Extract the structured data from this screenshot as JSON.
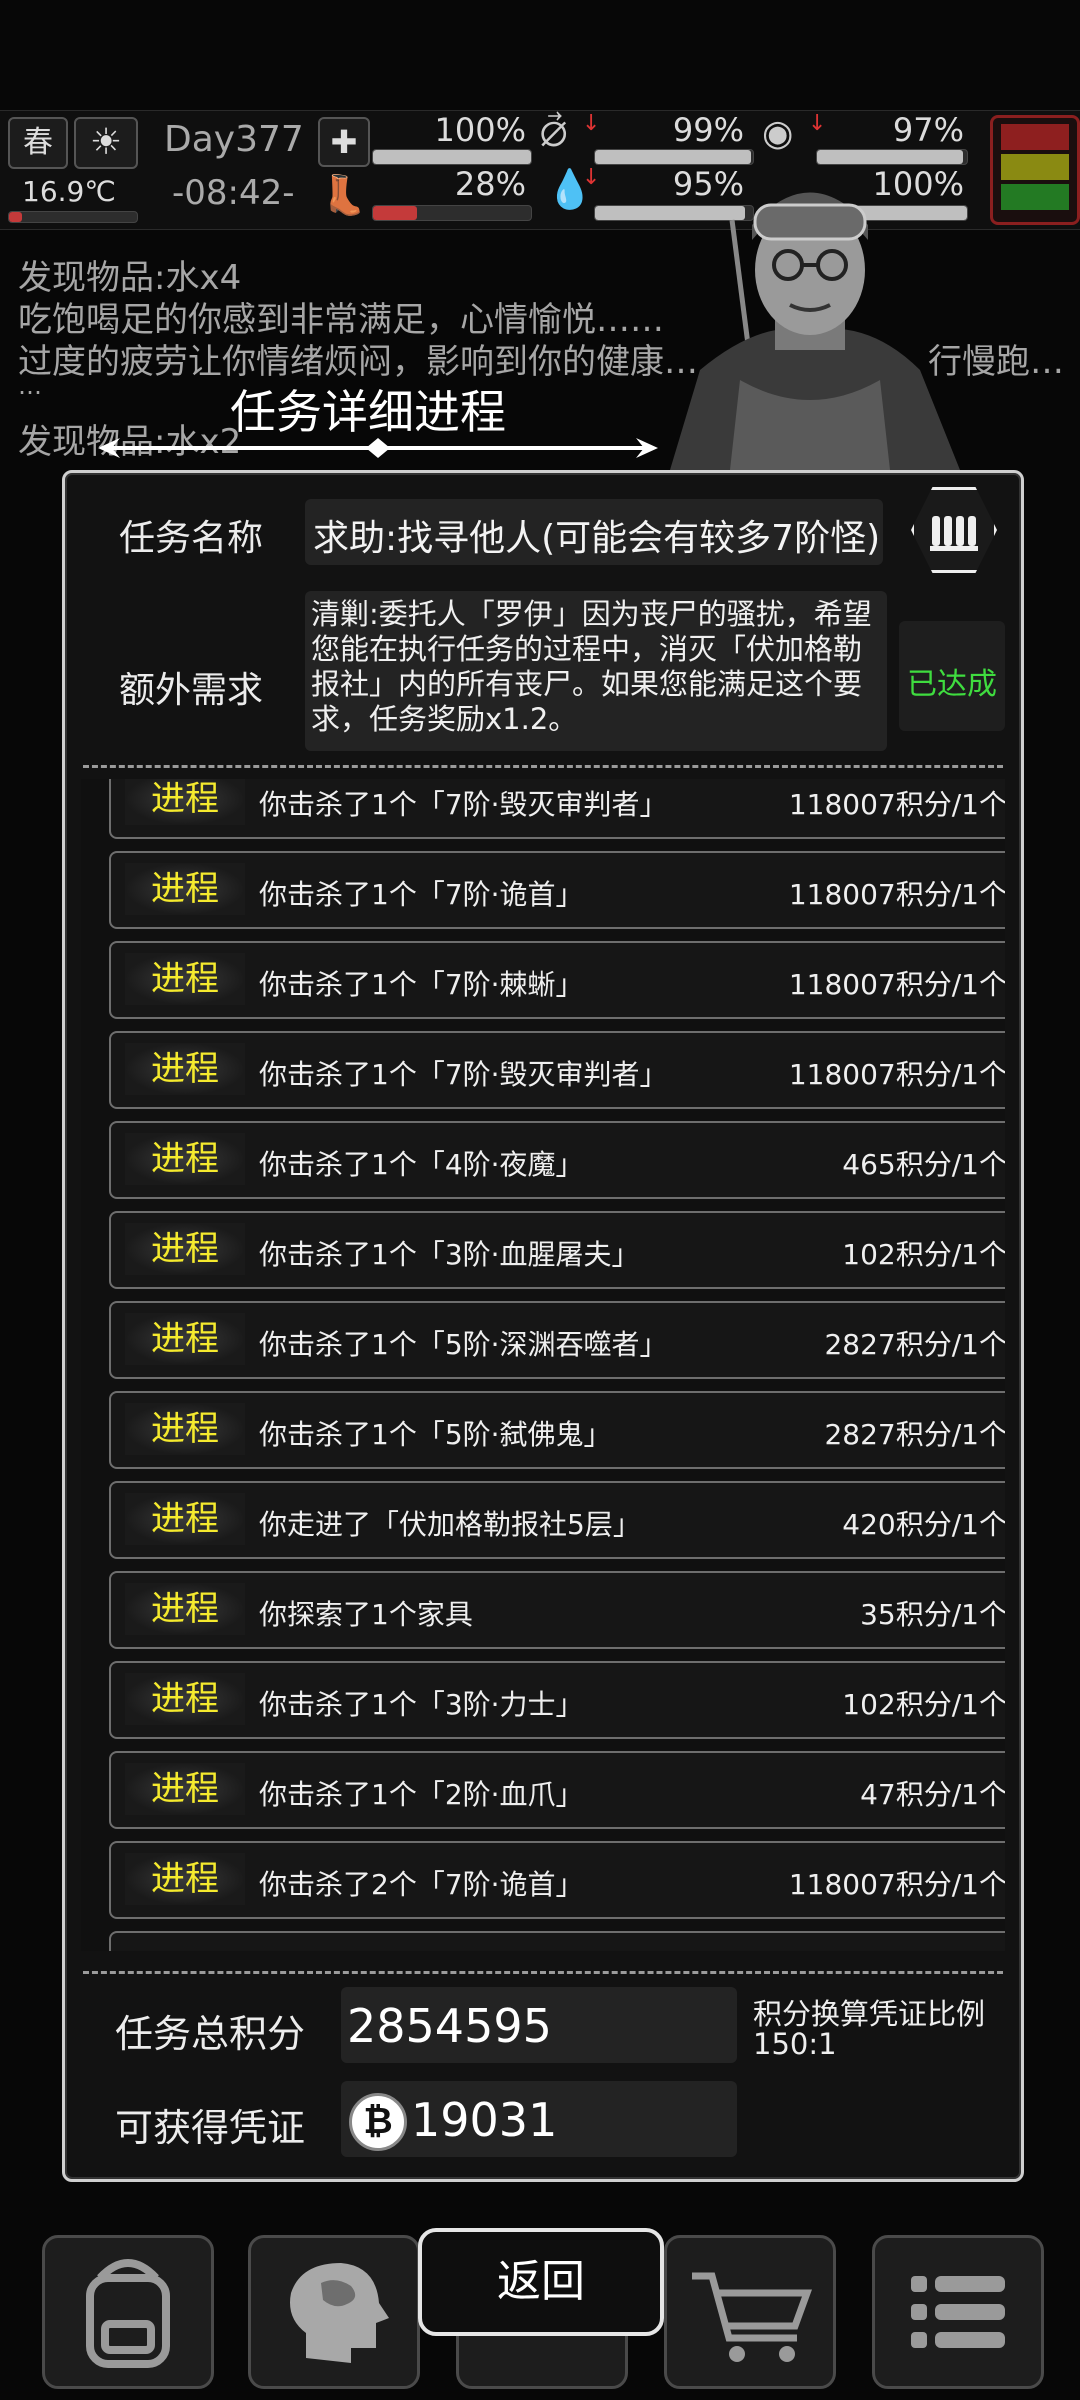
{
  "status": {
    "season": "春",
    "temperature": "16.9℃",
    "day": "Day377",
    "clock": "-08:42-",
    "health_pct": "100%",
    "stamina_pct": "28%",
    "hunger_pct": "99%",
    "thirst_pct": "95%",
    "mood_pct": "97%",
    "armor_pct": "100%",
    "levels": {
      "health": 1.0,
      "stamina": 0.28,
      "hunger": 0.99,
      "thirst": 0.95,
      "mood": 0.97,
      "armor": 1.0
    }
  },
  "log": [
    "发现物品:水x4",
    "吃饱喝足的你感到非常满足，心情愉悦……",
    "过度的疲劳让你情绪烦闷，影响到你的健康…",
    "…",
    "发现物品:水x2",
    "行慢跑…"
  ],
  "modal": {
    "title": "任务详细进程",
    "task_name_label": "任务名称",
    "task_name": "求助:找寻他人(可能会有较多7阶怪)",
    "extra_label": "额外需求",
    "extra_text": "清剿:委托人「罗伊」因为丧尸的骚扰，希望您能在执行任务的过程中，消灭「伏加格勒报社」内的所有丧尸。如果您能满足这个要求，任务奖励x1.2。",
    "extra_status": "已达成",
    "progress_tag": "进程",
    "entries": [
      {
        "desc": "你击杀了1个「7阶·毁灭审判者」",
        "pts": "118007积分/1个"
      },
      {
        "desc": "你击杀了1个「7阶·诡首」",
        "pts": "118007积分/1个"
      },
      {
        "desc": "你击杀了1个「7阶·棘蜥」",
        "pts": "118007积分/1个"
      },
      {
        "desc": "你击杀了1个「7阶·毁灭审判者」",
        "pts": "118007积分/1个"
      },
      {
        "desc": "你击杀了1个「4阶·夜魔」",
        "pts": "465积分/1个"
      },
      {
        "desc": "你击杀了1个「3阶·血腥屠夫」",
        "pts": "102积分/1个"
      },
      {
        "desc": "你击杀了1个「5阶·深渊吞噬者」",
        "pts": "2827积分/1个"
      },
      {
        "desc": "你击杀了1个「5阶·弑佛鬼」",
        "pts": "2827积分/1个"
      },
      {
        "desc": "你走进了「伏加格勒报社5层」",
        "pts": "420积分/1个"
      },
      {
        "desc": "你探索了1个家具",
        "pts": "35积分/1个"
      },
      {
        "desc": "你击杀了1个「3阶·力士」",
        "pts": "102积分/1个"
      },
      {
        "desc": "你击杀了1个「2阶·血爪」",
        "pts": "47积分/1个"
      },
      {
        "desc": "你击杀了2个「7阶·诡首」",
        "pts": "118007积分/1个"
      }
    ],
    "total_label": "任务总积分",
    "total_value": "2854595",
    "ratio_label": "积分换算凭证比例",
    "ratio_value": "150:1",
    "voucher_label": "可获得凭证",
    "voucher_value": "19031"
  },
  "nav": {
    "back": "返回",
    "items": [
      "backpack-icon",
      "brain-icon",
      "cart-icon",
      "menu-icon"
    ]
  },
  "colors": {
    "accent_yellow": "#f5ea2e",
    "success_green": "#3fdc3f",
    "danger_red": "#c43a3a"
  }
}
